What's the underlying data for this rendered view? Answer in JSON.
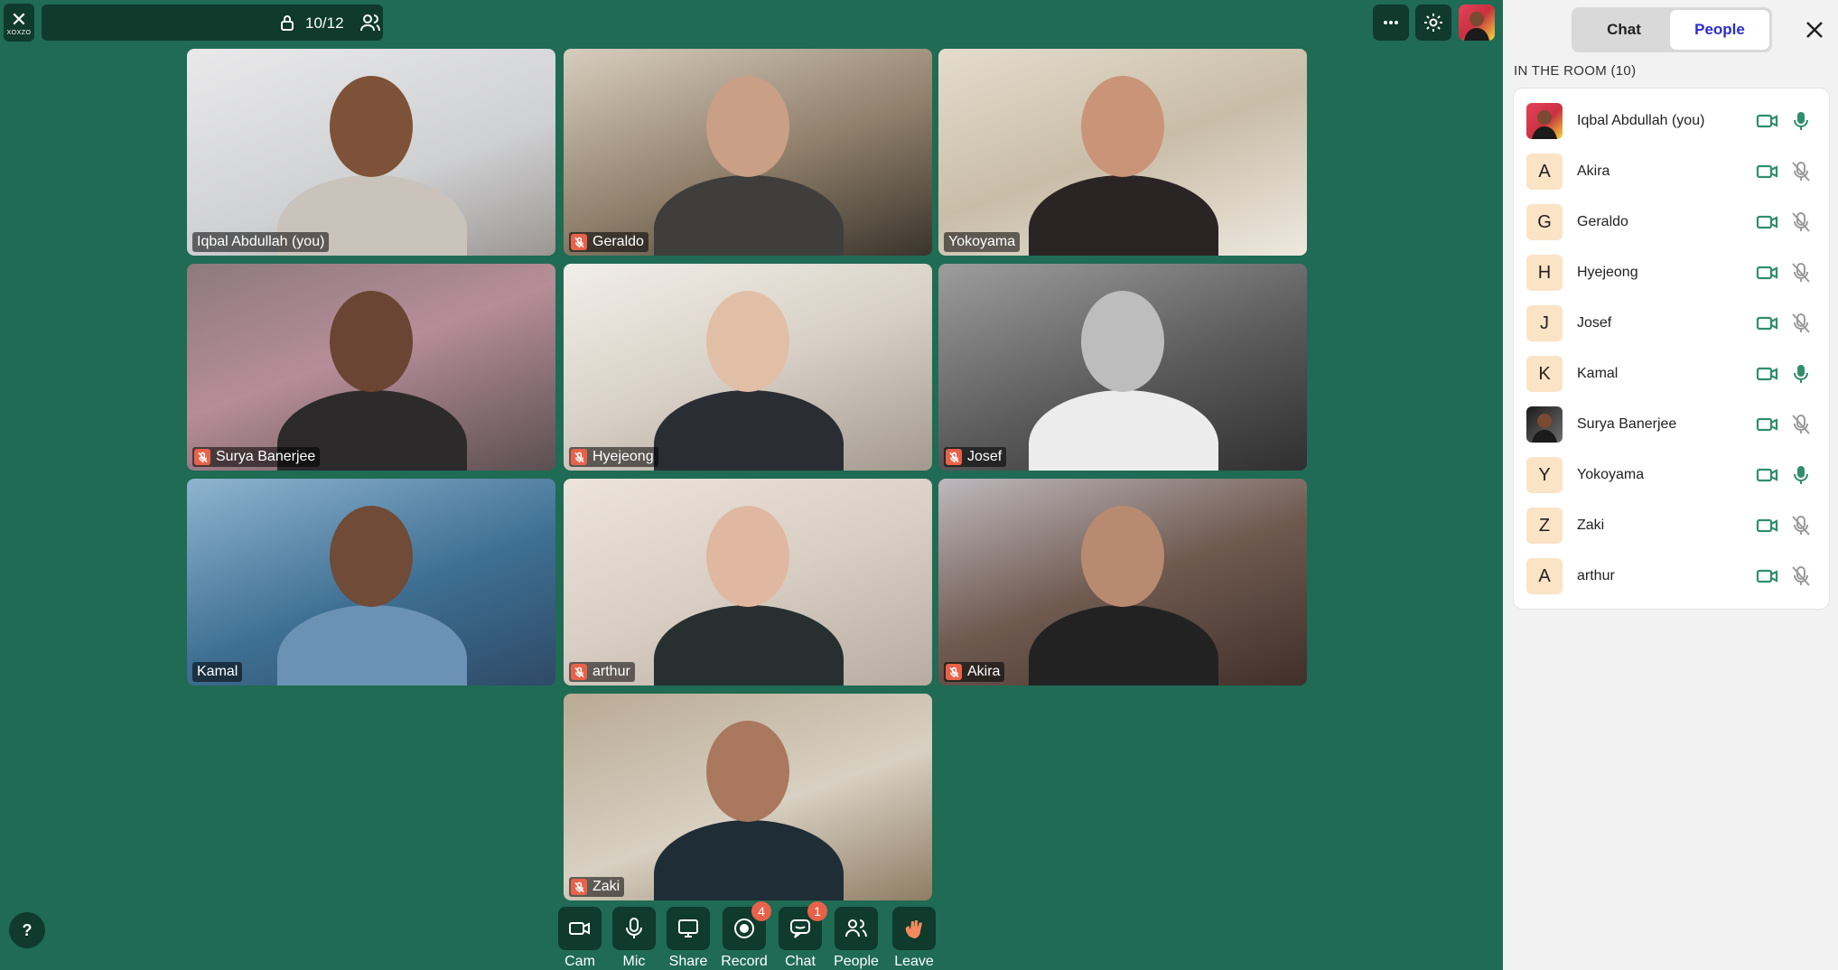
{
  "app": {
    "logo_text": "XOXZO",
    "room_count": "10/12"
  },
  "colors": {
    "stage_bg": "#1f6b54",
    "control_bg": "#0f3a2c",
    "muted_badge": "#e8624a",
    "active_tab_text": "#2a2bd1",
    "cam_on": "#2f8f6b",
    "mic_on": "#2f8f6b",
    "mic_off": "#9a9a9a"
  },
  "tiles": [
    {
      "name": "Iqbal Abdullah (you)",
      "muted": false
    },
    {
      "name": "Geraldo",
      "muted": true
    },
    {
      "name": "Yokoyama",
      "muted": false
    },
    {
      "name": "Surya Banerjee",
      "muted": true
    },
    {
      "name": "Hyejeong",
      "muted": true
    },
    {
      "name": "Josef",
      "muted": true
    },
    {
      "name": "Kamal",
      "muted": false
    },
    {
      "name": "arthur",
      "muted": true
    },
    {
      "name": "Akira",
      "muted": true
    },
    {
      "name": "Zaki",
      "muted": true
    }
  ],
  "controls": [
    {
      "label": "Cam",
      "icon": "camera-icon"
    },
    {
      "label": "Mic",
      "icon": "mic-icon"
    },
    {
      "label": "Share",
      "icon": "screen-share-icon"
    },
    {
      "label": "Record",
      "icon": "record-icon",
      "badge": "4"
    },
    {
      "label": "Chat",
      "icon": "chat-icon",
      "badge": "1"
    },
    {
      "label": "People",
      "icon": "people-icon"
    },
    {
      "label": "Leave",
      "icon": "wave-hand-icon"
    }
  ],
  "help": "?",
  "panel": {
    "tabs": [
      "Chat",
      "People"
    ],
    "active_tab": "People",
    "section_title": "IN THE ROOM (10)",
    "participants": [
      {
        "initial": "",
        "name": "Iqbal Abdullah (you)",
        "mic_on": true,
        "photo": true
      },
      {
        "initial": "A",
        "name": "Akira",
        "mic_on": false
      },
      {
        "initial": "G",
        "name": "Geraldo",
        "mic_on": false
      },
      {
        "initial": "H",
        "name": "Hyejeong",
        "mic_on": false
      },
      {
        "initial": "J",
        "name": "Josef",
        "mic_on": false
      },
      {
        "initial": "K",
        "name": "Kamal",
        "mic_on": true
      },
      {
        "initial": "",
        "name": "Surya Banerjee",
        "mic_on": false,
        "photo": true
      },
      {
        "initial": "Y",
        "name": "Yokoyama",
        "mic_on": true
      },
      {
        "initial": "Z",
        "name": "Zaki",
        "mic_on": false
      },
      {
        "initial": "A",
        "name": "arthur",
        "mic_on": false
      }
    ]
  }
}
